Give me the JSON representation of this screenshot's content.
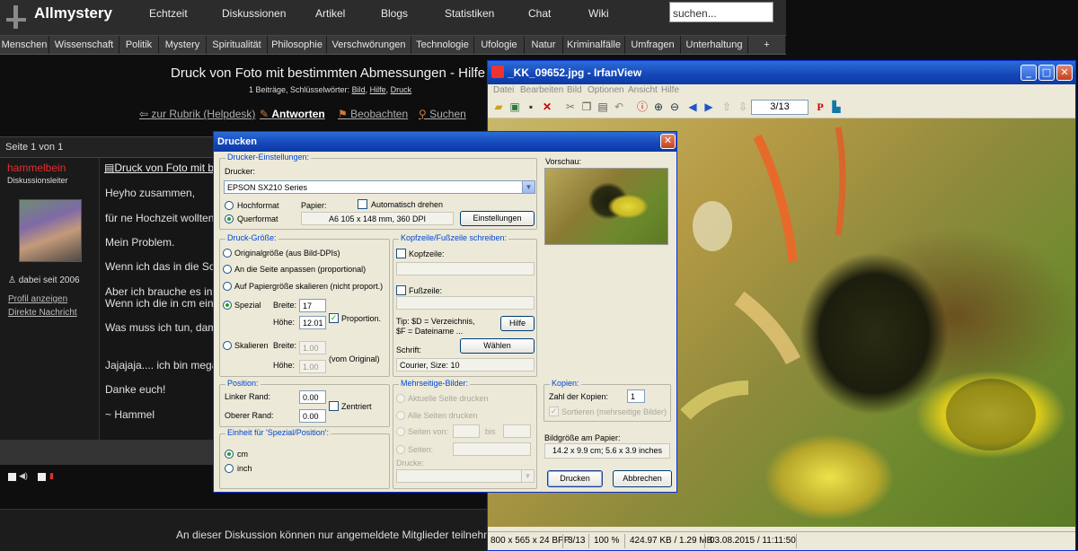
{
  "site": {
    "logo": "Allmystery",
    "nav": [
      "Echtzeit",
      "Diskussionen",
      "Artikel",
      "Blogs",
      "Statistiken",
      "Chat",
      "Wiki"
    ],
    "search_placeholder": "suchen...",
    "categories": [
      "Menschen",
      "Wissenschaft",
      "Politik",
      "Mystery",
      "Spiritualität",
      "Philosophie",
      "Verschwörungen",
      "Technologie",
      "Ufologie",
      "Natur",
      "Kriminalfälle",
      "Umfragen",
      "Unterhaltung",
      "+"
    ],
    "thread_title": "Druck von Foto mit bestimmten Abmessungen - Hilfe",
    "thread_meta_prefix": "1 Beiträge, Schlüsselwörter: ",
    "keywords": [
      "Bild",
      "Hilfe",
      "Druck"
    ],
    "actions": {
      "back": "zur Rubrik (Helpdesk)",
      "reply": "Antworten",
      "watch": "Beobachten",
      "search": "Suchen"
    },
    "page_label": "Seite 1 von 1",
    "post": {
      "author": "hammelbein",
      "role": "Diskussionsleiter",
      "since": "dabei seit 2006",
      "profile_link": "Profil anzeigen",
      "pm_link": "Direkte Nachricht",
      "title_link": "Druck von Foto mit bestimmten Abmessungen",
      "lines": [
        "Heyho zusammen,",
        "für ne Hochzeit wollten wir",
        "Mein Problem.",
        "Wenn ich das in die Software",
        "Aber ich brauche es in bestimmten",
        "Wenn ich die in cm eingebe",
        "Was muss ich tun, damit",
        "Jajajaja.... ich bin mega",
        "Danke euch!",
        "~ Hammel"
      ]
    },
    "members_only": "An dieser Diskussion können nur angemeldete Mitglieder teilnehmen."
  },
  "irfanview": {
    "title": "_KK_09652.jpg - IrfanView",
    "menu": [
      "Datei",
      "Bearbeiten",
      "Bild",
      "Optionen",
      "Ansicht",
      "Hilfe"
    ],
    "page_box": "3/13",
    "status": [
      "800 x 565 x 24 BPP",
      "3/13",
      "100 %",
      "424.97 KB / 1.29 MB",
      "03.08.2015 / 11:11:50"
    ]
  },
  "print_dialog": {
    "title": "Drucken",
    "printer_settings": {
      "title": "Drucker-Einstellungen:",
      "printer_label": "Drucker:",
      "printer": "EPSON SX210 Series",
      "portrait": "Hochformat",
      "landscape": "Querformat",
      "paper_label": "Papier:",
      "auto_rotate": "Automatisch drehen",
      "paper": "A6 105 x 148 mm,   360 DPI",
      "settings_button": "Einstellungen"
    },
    "preview_label": "Vorschau:",
    "print_size": {
      "title": "Druck-Größe:",
      "original": "Originalgröße (aus Bild-DPIs)",
      "fit": "An die Seite anpassen (proportional)",
      "stretch": "Auf Papiergröße skalieren (nicht proport.)",
      "custom": "Spezial",
      "width_label": "Breite:",
      "width": "17",
      "height_label": "Höhe:",
      "height": "12.01",
      "proportional": "Proportion.",
      "scale": "Skalieren",
      "scale_width": "1.00",
      "scale_height": "1.00",
      "from_original": "(vom Original)"
    },
    "header_footer": {
      "title": "Kopfzeile/Fußzeile schreiben:",
      "header": "Kopfzeile:",
      "footer": "Fußzeile:",
      "tip_line1": "Tip: $D = Verzeichnis,",
      "tip_line2": "$F = Dateiname ...",
      "help_button": "Hilfe",
      "font_label": "Schrift:",
      "choose_button": "Wählen",
      "font": "Courier, Size: 10"
    },
    "position": {
      "title": "Position:",
      "left_label": "Linker Rand:",
      "left": "0.00",
      "top_label": "Oberer Rand:",
      "top": "0.00",
      "centered": "Zentriert"
    },
    "units": {
      "title": "Einheit für 'Spezial/Position':",
      "cm": "cm",
      "inch": "inch"
    },
    "multipage": {
      "title": "Mehrseitige-Bilder:",
      "current": "Aktuelle Seite drucken",
      "all": "Alle Seiten drucken",
      "pages_from": "Seiten von:",
      "to": "bis",
      "pages": "Seiten:",
      "prints_label": "Drucke:"
    },
    "copies": {
      "title": "Kopien:",
      "count_label": "Zahl der Kopien:",
      "count": "1",
      "sort": "Sortieren (mehrseitige Bilder)"
    },
    "paper_size": {
      "label": "Bildgröße am Papier:",
      "value": "14.2 x 9.9 cm; 5.6 x 3.9 inches"
    },
    "print_button": "Drucken",
    "cancel_button": "Abbrechen"
  }
}
